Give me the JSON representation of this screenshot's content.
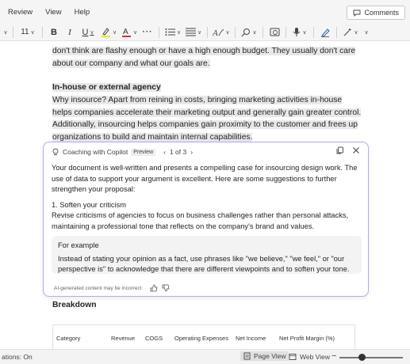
{
  "menu": {
    "items": [
      "Review",
      "View",
      "Help"
    ],
    "comments_label": "Comments"
  },
  "toolbar": {
    "font_size": "11"
  },
  "document": {
    "para1": "don't think are flashy enough or have a high enough budget. They usually don't care about our company and what our goals are.",
    "heading1": "In-house or external agency",
    "para2": "Why insource? Apart from reining in costs, bringing marketing activities in-house helps companies accelerate their marketing output and generally gain greater control. Additionally, insourcing helps companies gain proximity to the customer and frees up organizations to build and maintain internal capabilities.",
    "heading2": "Breakdown"
  },
  "copilot": {
    "title": "Coaching with Copilot",
    "badge": "Preview",
    "pager": "1 of 3",
    "intro": "Your document is well-written and presents a compelling case for insourcing design work. The use of data to support your argument is excellent. Here are some suggestions to further strengthen your proposal:",
    "point_title": "1. Soften your criticism",
    "point_text": "Revise criticisms of agencies to focus on business challenges rather than personal attacks, maintaining a professional tone that reflects on the company's brand and values.",
    "example_title": "For example",
    "example_text": "Instead of stating your opinion as a fact, use phrases like \"we believe,\" \"we feel,\" or \"our perspective is\" to acknowledge that there are different viewpoints and to soften your tone.",
    "disclaimer": "AI-generated content may be incorrect"
  },
  "table": {
    "headers": [
      "Category",
      "Revenue",
      "COGS",
      "Operating Expenses",
      "Net Income",
      "Net Profit Margin (%)"
    ]
  },
  "status": {
    "left": "ations: On",
    "page_view": "Page View",
    "web_view": "Web View",
    "zoom_fraction": 0.35
  },
  "colors": {
    "accent": "#7a5af8",
    "highlight": "#e8e8e8"
  }
}
